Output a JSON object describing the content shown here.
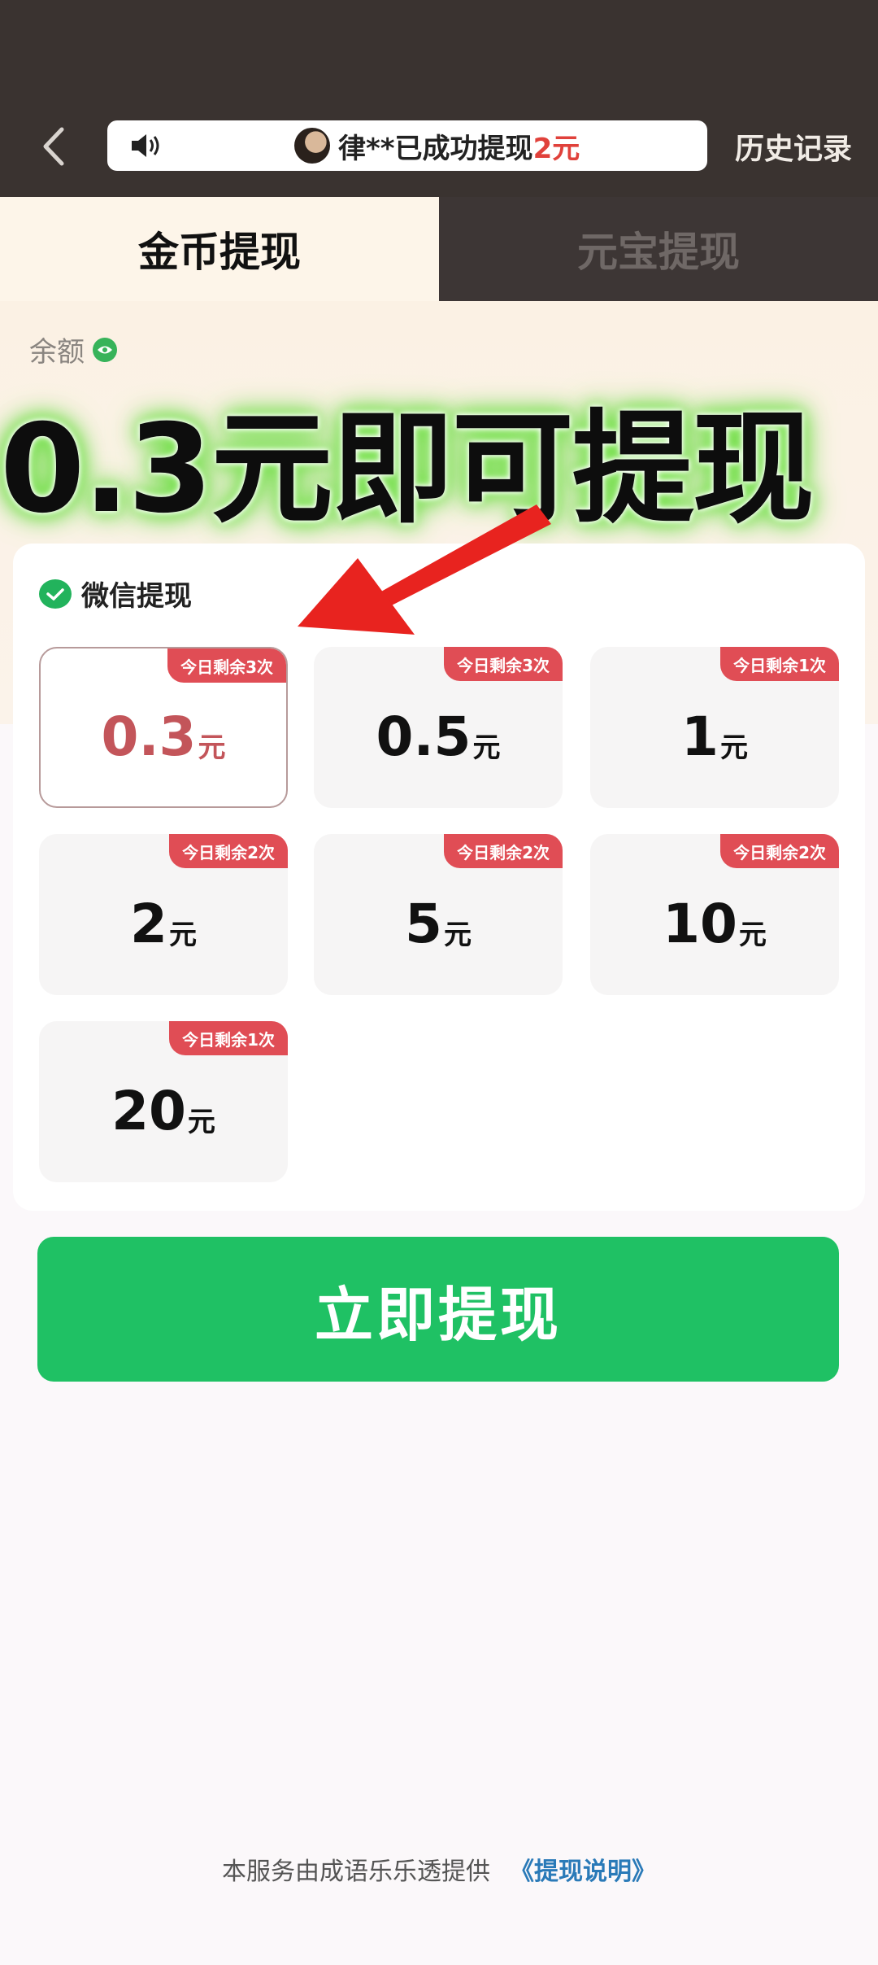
{
  "header": {
    "notice_user": "律**已成功提现",
    "notice_amount": "2元",
    "history_label": "历史记录"
  },
  "tabs": [
    {
      "label": "金币提现",
      "active": true
    },
    {
      "label": "元宝提现",
      "active": false
    }
  ],
  "balance": {
    "label": "余额",
    "headline": "0.3元即可提现"
  },
  "wechat_label": "微信提现",
  "options": [
    {
      "value": "0.3",
      "unit": "元",
      "badge": "今日剩余3次",
      "selected": true
    },
    {
      "value": "0.5",
      "unit": "元",
      "badge": "今日剩余3次",
      "selected": false
    },
    {
      "value": "1",
      "unit": "元",
      "badge": "今日剩余1次",
      "selected": false
    },
    {
      "value": "2",
      "unit": "元",
      "badge": "今日剩余2次",
      "selected": false
    },
    {
      "value": "5",
      "unit": "元",
      "badge": "今日剩余2次",
      "selected": false
    },
    {
      "value": "10",
      "unit": "元",
      "badge": "今日剩余2次",
      "selected": false
    },
    {
      "value": "20",
      "unit": "元",
      "badge": "今日剩余1次",
      "selected": false
    }
  ],
  "withdraw_button": "立即提现",
  "footer": {
    "text": "本服务由成语乐乐透提供",
    "link": "《提现说明》"
  },
  "colors": {
    "accent_green": "#1fc164",
    "badge_red": "#e04d55",
    "header_dark": "#3a3330"
  },
  "icons": {
    "back": "chevron-left-icon",
    "speaker": "speaker-icon",
    "eye": "eye-icon",
    "wechat": "wechat-icon",
    "arrow": "red-arrow"
  }
}
